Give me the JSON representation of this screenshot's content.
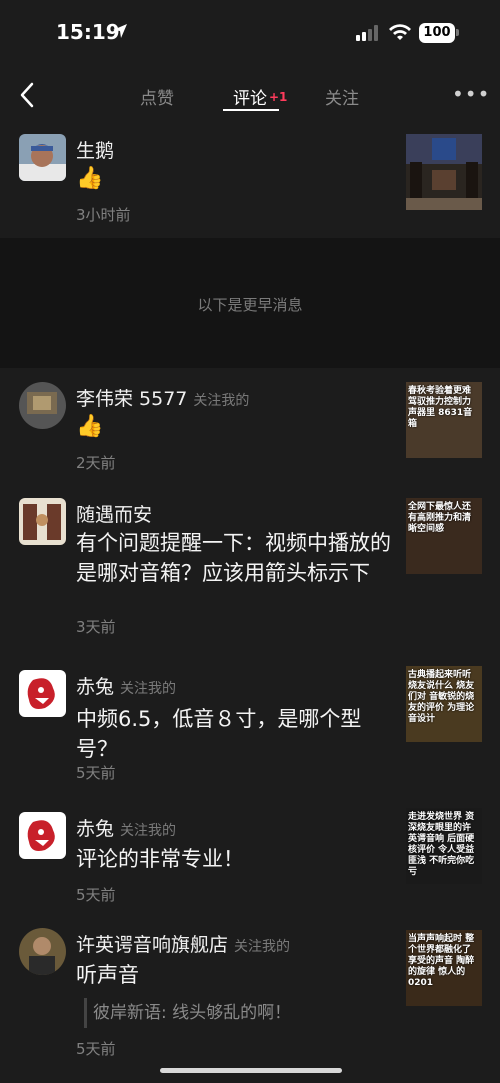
{
  "status_bar": {
    "time": "15:19",
    "battery": "100",
    "icons": [
      "location-arrow-icon",
      "signal-icon",
      "wifi-icon",
      "battery-icon"
    ]
  },
  "nav": {
    "tabs": [
      {
        "label": "点赞",
        "active": false
      },
      {
        "label": "评论",
        "badge": "+1",
        "active": true
      },
      {
        "label": "关注",
        "active": false
      }
    ],
    "more_label": "•••"
  },
  "colors": {
    "background": "#1c1c1c",
    "separator": "#141414",
    "badge": "#ff3b5c",
    "muted": "#808080"
  },
  "items": [
    {
      "name": "生鹅",
      "follow_tag": "",
      "comment": "👍",
      "time": "3小时前",
      "thumb_text": ""
    },
    {
      "name": "李伟荣 5577",
      "follow_tag": "关注我的",
      "comment": "👍",
      "time": "2天前",
      "thumb_text": "春秋考验着更难驾驭推力控制力 声器里 8631音箱"
    },
    {
      "name": "随遇而安",
      "follow_tag": "",
      "comment": "有个问题提醒一下：视频中播放的是哪对音箱？应该用箭头标示下",
      "time": "3天前",
      "thumb_text": "全网下最惊人还有高刚推力和清晰空间感"
    },
    {
      "name": "赤兔",
      "follow_tag": "关注我的",
      "comment": "中频6.5，低音８寸，是哪个型号？",
      "time": "5天前",
      "thumb_text": "古典播起来听听烧友说什么 烧友们对 音敏锐的烧友的评价 为理论音设计"
    },
    {
      "name": "赤兔",
      "follow_tag": "关注我的",
      "comment": "评论的非常专业！",
      "time": "5天前",
      "thumb_text": "走进发烧世界 资深烧友眼里的许英谔音响 后面硬核评价 令人受益匪浅 不听完你吃亏"
    },
    {
      "name": "许英谔音响旗舰店",
      "follow_tag": "关注我的",
      "comment": "听声音",
      "reply_quote": "彼岸新语: 线头够乱的啊！",
      "time": "5天前",
      "thumb_text": "当声声响起时 整个世界都融化了 享受的声音 陶醉的旋律 惊人的0201"
    }
  ],
  "separator_text": "以下是更早消息"
}
